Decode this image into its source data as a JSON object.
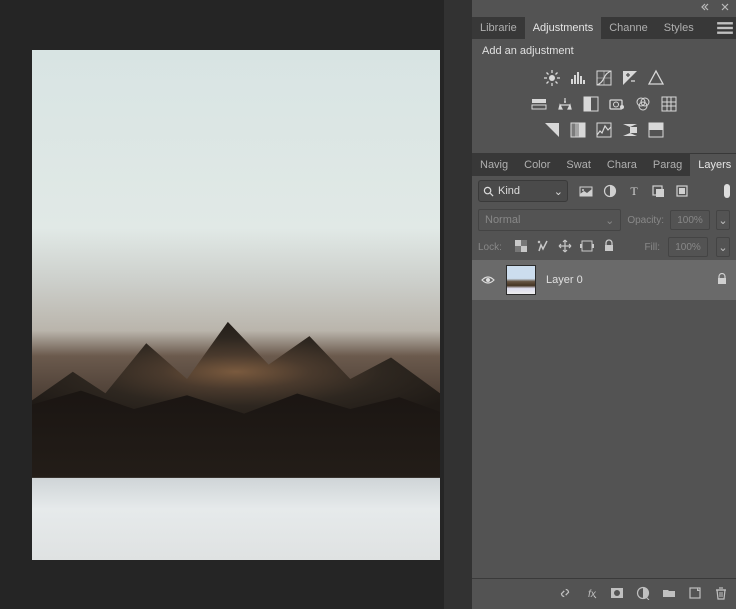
{
  "topbar": {},
  "adjustments_panel": {
    "tabs": [
      "Libraries",
      "Adjustments",
      "Channels",
      "Styles"
    ],
    "tab_labels": {
      "libraries": "Librarie",
      "adjustments": "Adjustments",
      "channels": "Channe",
      "styles": "Styles"
    },
    "active_tab": "Adjustments",
    "header": "Add an adjustment"
  },
  "layers_panel": {
    "tabs": [
      "Navigator",
      "Color",
      "Swatches",
      "Character",
      "Paragraph",
      "Layers"
    ],
    "tab_labels": {
      "navigator": "Navig",
      "color": "Color",
      "swatches": "Swat",
      "character": "Chara",
      "paragraph": "Parag",
      "layers": "Layers"
    },
    "active_tab": "Layers",
    "filter": {
      "kind_label": "Kind"
    },
    "blend": {
      "mode": "Normal",
      "opacity_label": "Opacity:",
      "opacity_value": "100%"
    },
    "lock": {
      "label": "Lock:",
      "fill_label": "Fill:",
      "fill_value": "100%"
    },
    "layers": [
      {
        "name": "Layer 0",
        "visible": true,
        "locked": true
      }
    ]
  }
}
